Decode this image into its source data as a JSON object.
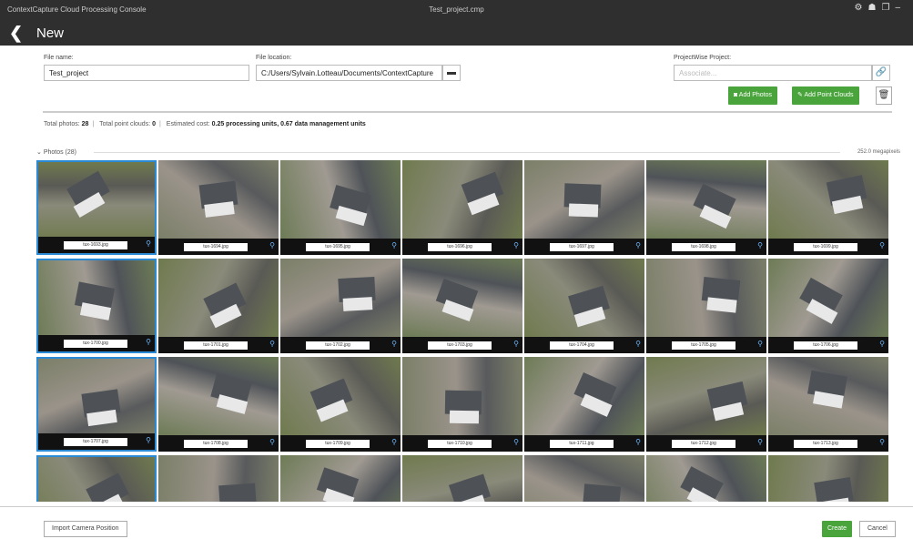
{
  "titlebar": {
    "app": "ContextCapture Cloud Processing Console",
    "file": "Test_project.cmp",
    "back": "❮",
    "title": "New",
    "icons": [
      "settings-icon",
      "user-icon",
      "restore-icon",
      "minimize-icon"
    ]
  },
  "form": {
    "file_name_label": "File name:",
    "file_name_value": "Test_project",
    "file_location_label": "File location:",
    "file_location_value": "C:/Users/Sylvain.Lotteau/Documents/ContextCapture",
    "projectwise_label": "ProjectWise Project:",
    "projectwise_placeholder": "Associate..."
  },
  "buttons": {
    "add_photos": "Add Photos",
    "add_point_clouds": "Add Point Clouds",
    "import_camera": "Import Camera Position",
    "create": "Create",
    "cancel": "Cancel"
  },
  "summary": {
    "photos_label": "Total photos:",
    "photos_value": "28",
    "clouds_label": "Total point clouds:",
    "clouds_value": "0",
    "cost_label": "Estimated cost:",
    "cost_value": "0.25 processing units, 0.67 data management units"
  },
  "section": {
    "title": "Photos (28)",
    "megapixels": "252.0 megapixels"
  },
  "photos": [
    "tux-1693.jpg",
    "tux-1694.jpg",
    "tux-1695.jpg",
    "tux-1696.jpg",
    "tux-1697.jpg",
    "tux-1698.jpg",
    "tux-1699.jpg",
    "tux-1700.jpg",
    "tux-1701.jpg",
    "tux-1702.jpg",
    "tux-1703.jpg",
    "tux-1704.jpg",
    "tux-1705.jpg",
    "tux-1706.jpg",
    "tux-1707.jpg",
    "tux-1708.jpg",
    "tux-1709.jpg",
    "tux-1710.jpg",
    "tux-1711.jpg",
    "tux-1712.jpg",
    "tux-1713.jpg",
    "",
    "",
    "",
    "",
    "",
    "",
    ""
  ],
  "colors": {
    "accent": "#2a8ad6",
    "green": "#4aa43c",
    "titlebar": "#2f2f2f"
  }
}
